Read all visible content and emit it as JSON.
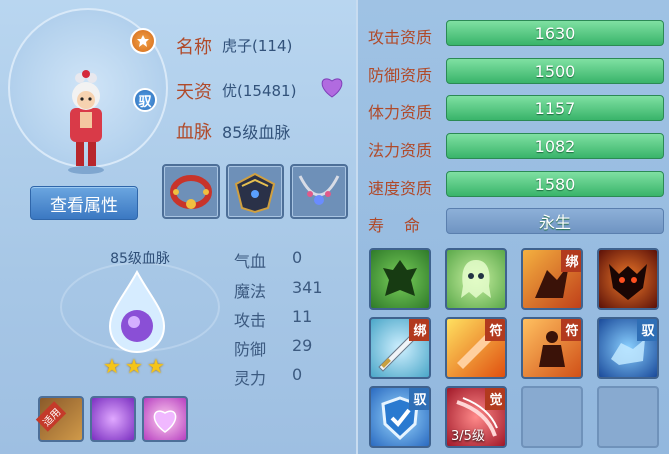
{
  "pet": {
    "name_label": "名称",
    "name_value": "虎子(114)",
    "talent_label": "天资",
    "talent_value": "优(15481)",
    "blood_label": "血脉",
    "blood_value": "85级血脉",
    "view_button": "查看属性",
    "yu_badge": "驭"
  },
  "bloodline": {
    "label": "85级血脉",
    "stars": 3
  },
  "stats": [
    {
      "label": "气血",
      "value": "0"
    },
    {
      "label": "魔法",
      "value": "341"
    },
    {
      "label": "攻击",
      "value": "11"
    },
    {
      "label": "防御",
      "value": "29"
    },
    {
      "label": "灵力",
      "value": "0"
    }
  ],
  "aptitudes": [
    {
      "label": "攻击资质",
      "value": "1630"
    },
    {
      "label": "防御资质",
      "value": "1500"
    },
    {
      "label": "体力资质",
      "value": "1157"
    },
    {
      "label": "法力资质",
      "value": "1082"
    },
    {
      "label": "速度资质",
      "value": "1580"
    }
  ],
  "lifespan": {
    "label": "寿　命",
    "value": "永生"
  },
  "pills": {
    "first_tag": "适用"
  },
  "skills": [
    {
      "tag": ""
    },
    {
      "tag": ""
    },
    {
      "tag": "绑"
    },
    {
      "tag": ""
    },
    {
      "tag": "绑"
    },
    {
      "tag": "符"
    },
    {
      "tag": "符"
    },
    {
      "tag": "驭"
    },
    {
      "tag": "驭"
    },
    {
      "tag": "觉",
      "level": "3/5级"
    }
  ],
  "colors": {
    "label_red": "#b04a2a",
    "bar_green": "#39b46a",
    "panel_blue": "#a9c8e6"
  }
}
